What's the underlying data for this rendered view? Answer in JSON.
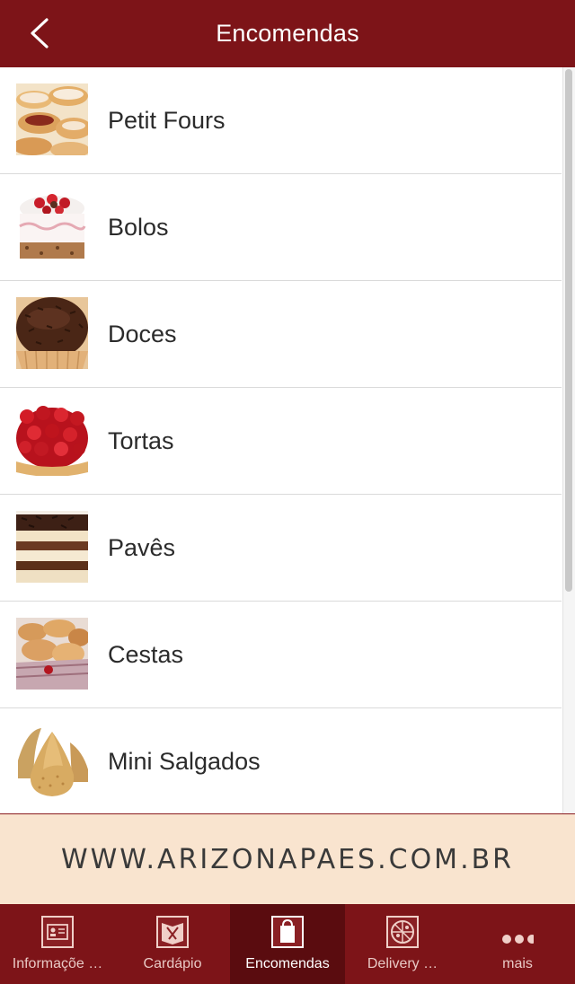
{
  "header": {
    "title": "Encomendas",
    "back_icon": "chevron-left-icon"
  },
  "list": {
    "items": [
      {
        "label": "Petit Fours",
        "thumb_icon": "petit-fours-thumbnail"
      },
      {
        "label": "Bolos",
        "thumb_icon": "cake-thumbnail"
      },
      {
        "label": "Doces",
        "thumb_icon": "brigadeiro-thumbnail"
      },
      {
        "label": "Tortas",
        "thumb_icon": "strawberry-tart-thumbnail"
      },
      {
        "label": "Pavês",
        "thumb_icon": "pave-thumbnail"
      },
      {
        "label": "Cestas",
        "thumb_icon": "basket-thumbnail"
      },
      {
        "label": "Mini Salgados",
        "thumb_icon": "coxinha-thumbnail"
      }
    ]
  },
  "banner": {
    "text": "WWW.ARIZONAPAES.COM.BR"
  },
  "tabbar": {
    "tabs": [
      {
        "label": "Informaçõe …",
        "icon": "info-card-icon",
        "active": false
      },
      {
        "label": "Cardápio",
        "icon": "menu-cutlery-icon",
        "active": false
      },
      {
        "label": "Encomendas",
        "icon": "shopping-bag-icon",
        "active": true
      },
      {
        "label": "Delivery …",
        "icon": "pizza-icon",
        "active": false
      },
      {
        "label": "mais",
        "icon": "more-dots-icon",
        "active": false
      }
    ]
  },
  "colors": {
    "brand": "#7d1418",
    "brand_active": "#5a0c0f",
    "banner_bg": "#f9e4cf"
  }
}
